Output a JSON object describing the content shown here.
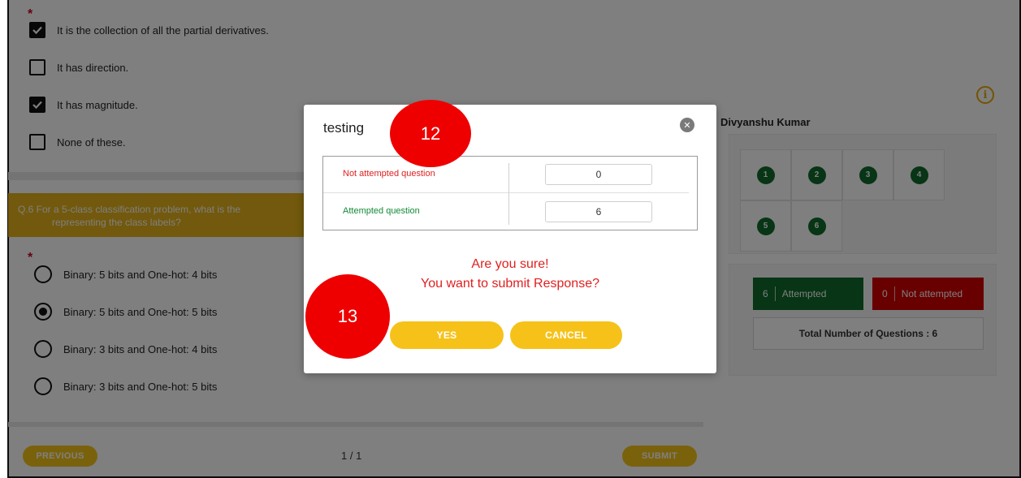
{
  "question_prev": {
    "required_mark": "*",
    "options": [
      {
        "label": "It is the collection of all the partial derivatives.",
        "checked": true
      },
      {
        "label": "It has direction.",
        "checked": false
      },
      {
        "label": "It has magnitude.",
        "checked": true
      },
      {
        "label": "None of these.",
        "checked": false
      }
    ]
  },
  "question_6": {
    "text_line1": "Q.6  For a 5-class classification problem, what is the",
    "text_line2": "representing the class labels?",
    "required_mark": "*",
    "options": [
      {
        "label": "Binary: 5 bits and One-hot: 4 bits",
        "selected": false
      },
      {
        "label": "Binary: 5 bits and One-hot: 5 bits",
        "selected": true
      },
      {
        "label": "Binary: 3 bits and One-hot: 4 bits",
        "selected": false
      },
      {
        "label": "Binary: 3 bits and One-hot: 5 bits",
        "selected": false
      }
    ]
  },
  "footer": {
    "previous_label": "PREVIOUS",
    "page_indicator": "1 / 1",
    "submit_label": "SUBMIT"
  },
  "sidebar": {
    "info_glyph": "i",
    "user_name": "Divyanshu Kumar",
    "questions": [
      "1",
      "2",
      "3",
      "4",
      "5",
      "6"
    ],
    "attempted_count": "6",
    "attempted_label": "Attempted",
    "not_attempted_count": "0",
    "not_attempted_label": "Not attempted",
    "total_label": "Total Number of Questions : 6"
  },
  "modal": {
    "title": "testing",
    "close_glyph": "✕",
    "not_attempted_label": "Not attempted question",
    "not_attempted_value": "0",
    "attempted_label": "Attempted question",
    "attempted_value": "6",
    "confirm_line1": "Are you sure!",
    "confirm_line2": "You want to submit Response?",
    "yes_label": "YES",
    "cancel_label": "CANCEL"
  },
  "annotations": {
    "marker_12": "12",
    "marker_13": "13"
  },
  "colors": {
    "accent_yellow": "#f5c518",
    "question_bar": "#e5b21a",
    "attempted_green": "#0f6b2a",
    "not_attempted_red": "#d10000",
    "confirm_red": "#e02020",
    "marker_red": "#ee0000"
  }
}
